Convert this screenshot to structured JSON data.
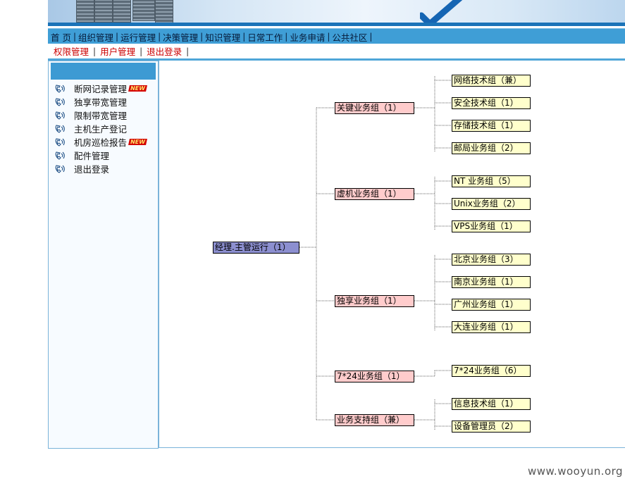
{
  "nav": {
    "primary": [
      "首 页",
      "组织管理",
      "运行管理",
      "决策管理",
      "知识管理",
      "日常工作",
      "业务申请",
      "公共社区"
    ],
    "secondary": [
      "权限管理",
      "用户管理",
      "退出登录"
    ]
  },
  "sidebar": {
    "new_badge": "NEW",
    "items": [
      {
        "label": "断网记录管理",
        "is_new": true
      },
      {
        "label": "独享带宽管理",
        "is_new": false
      },
      {
        "label": "限制带宽管理",
        "is_new": false
      },
      {
        "label": "主机生产登记",
        "is_new": false
      },
      {
        "label": "机房巡检报告",
        "is_new": true
      },
      {
        "label": "配件管理",
        "is_new": false
      },
      {
        "label": "退出登录",
        "is_new": false
      }
    ]
  },
  "org": {
    "root": "经理.主管运行（1）",
    "groups": [
      {
        "name": "关键业务组（1）",
        "children": [
          "网络技术组（兼）",
          "安全技术组（1）",
          "存储技术组（1）",
          "邮局业务组（2）"
        ]
      },
      {
        "name": "虚机业务组（1）",
        "children": [
          "NT 业务组（5）",
          "Unix业务组（2）",
          "VPS业务组（1）"
        ]
      },
      {
        "name": "独享业务组（1）",
        "children": [
          "北京业务组（3）",
          "南京业务组（1）",
          "广州业务组（1）",
          "大连业务组（1）"
        ]
      },
      {
        "name": "7*24业务组（1）",
        "children": [
          "7*24业务组（6）"
        ]
      },
      {
        "name": "业务支持组（兼）",
        "children": [
          "信息技术组（1）",
          "设备管理员（2）"
        ]
      }
    ]
  },
  "footer": "www.wooyun.org"
}
